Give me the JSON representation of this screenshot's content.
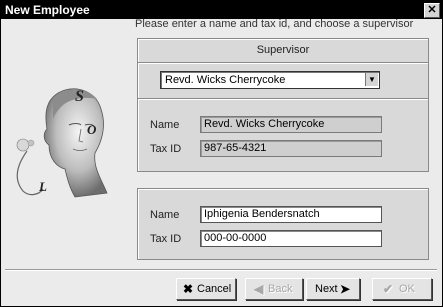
{
  "window": {
    "title": "New Employee"
  },
  "instructions": "Please enter a name and tax id, and choose a supervisor",
  "supervisor_group": {
    "title": "Supervisor",
    "dropdown": {
      "selected": "Revd. Wicks Cherrycoke"
    },
    "name_label": "Name",
    "name_value": "Revd. Wicks Cherrycoke",
    "taxid_label": "Tax ID",
    "taxid_value": "987-65-4321"
  },
  "employee_group": {
    "name_label": "Name",
    "name_value": "Iphigenia Bendersnatch",
    "taxid_label": "Tax ID",
    "taxid_value": "000-00-0000"
  },
  "buttons": {
    "cancel": "Cancel",
    "back": "Back",
    "next": "Next",
    "ok": "OK"
  },
  "art": {
    "letters": [
      "S",
      "O",
      "L"
    ]
  }
}
